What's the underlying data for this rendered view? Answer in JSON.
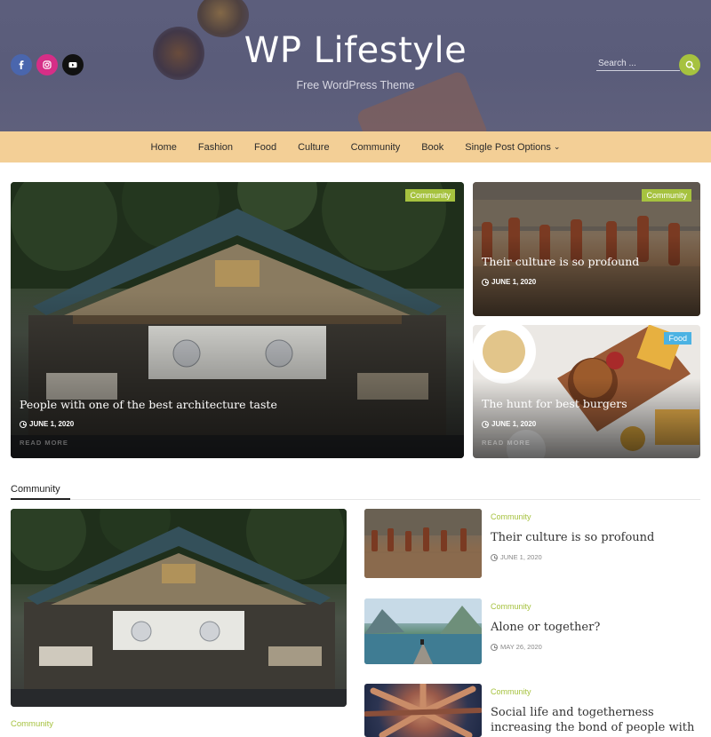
{
  "header": {
    "site_title": "WP Lifestyle",
    "tagline": "Free WordPress Theme",
    "social": [
      {
        "icon": "facebook-icon",
        "color": "#4a66ad"
      },
      {
        "icon": "instagram-icon",
        "color": "#d62e87"
      },
      {
        "icon": "youtube-icon",
        "color": "#111111"
      }
    ],
    "search": {
      "placeholder": "Search ...",
      "button_icon": "search-icon",
      "button_color": "#a6c23f"
    }
  },
  "nav": {
    "items": [
      "Home",
      "Fashion",
      "Food",
      "Culture",
      "Community",
      "Book",
      "Single Post Options"
    ],
    "background": "#f3cf96"
  },
  "slider": {
    "main": {
      "category": "Community",
      "title": "People with one of the best architecture taste",
      "date": "JUNE 1, 2020",
      "more": "READ MORE"
    },
    "side_top": {
      "category": "Community",
      "title": "Their culture is so profound",
      "date": "JUNE 1, 2020"
    },
    "side_bottom": {
      "category": "Food",
      "title": "The hunt for best burgers",
      "date": "JUNE 1, 2020",
      "more": "READ MORE"
    }
  },
  "section": {
    "heading": "Community",
    "featured": {
      "category": "Community"
    },
    "list": [
      {
        "category": "Community",
        "title": "Their culture is so profound",
        "date": "JUNE 1, 2020"
      },
      {
        "category": "Community",
        "title": "Alone or together?",
        "date": "MAY 26, 2020"
      },
      {
        "category": "Community",
        "title": "Social life and togetherness increasing the bond of people with the same"
      }
    ]
  },
  "colors": {
    "accent": "#a6c23f",
    "food_badge": "#4bb2e3",
    "header_bg": "#5c5e7c"
  }
}
